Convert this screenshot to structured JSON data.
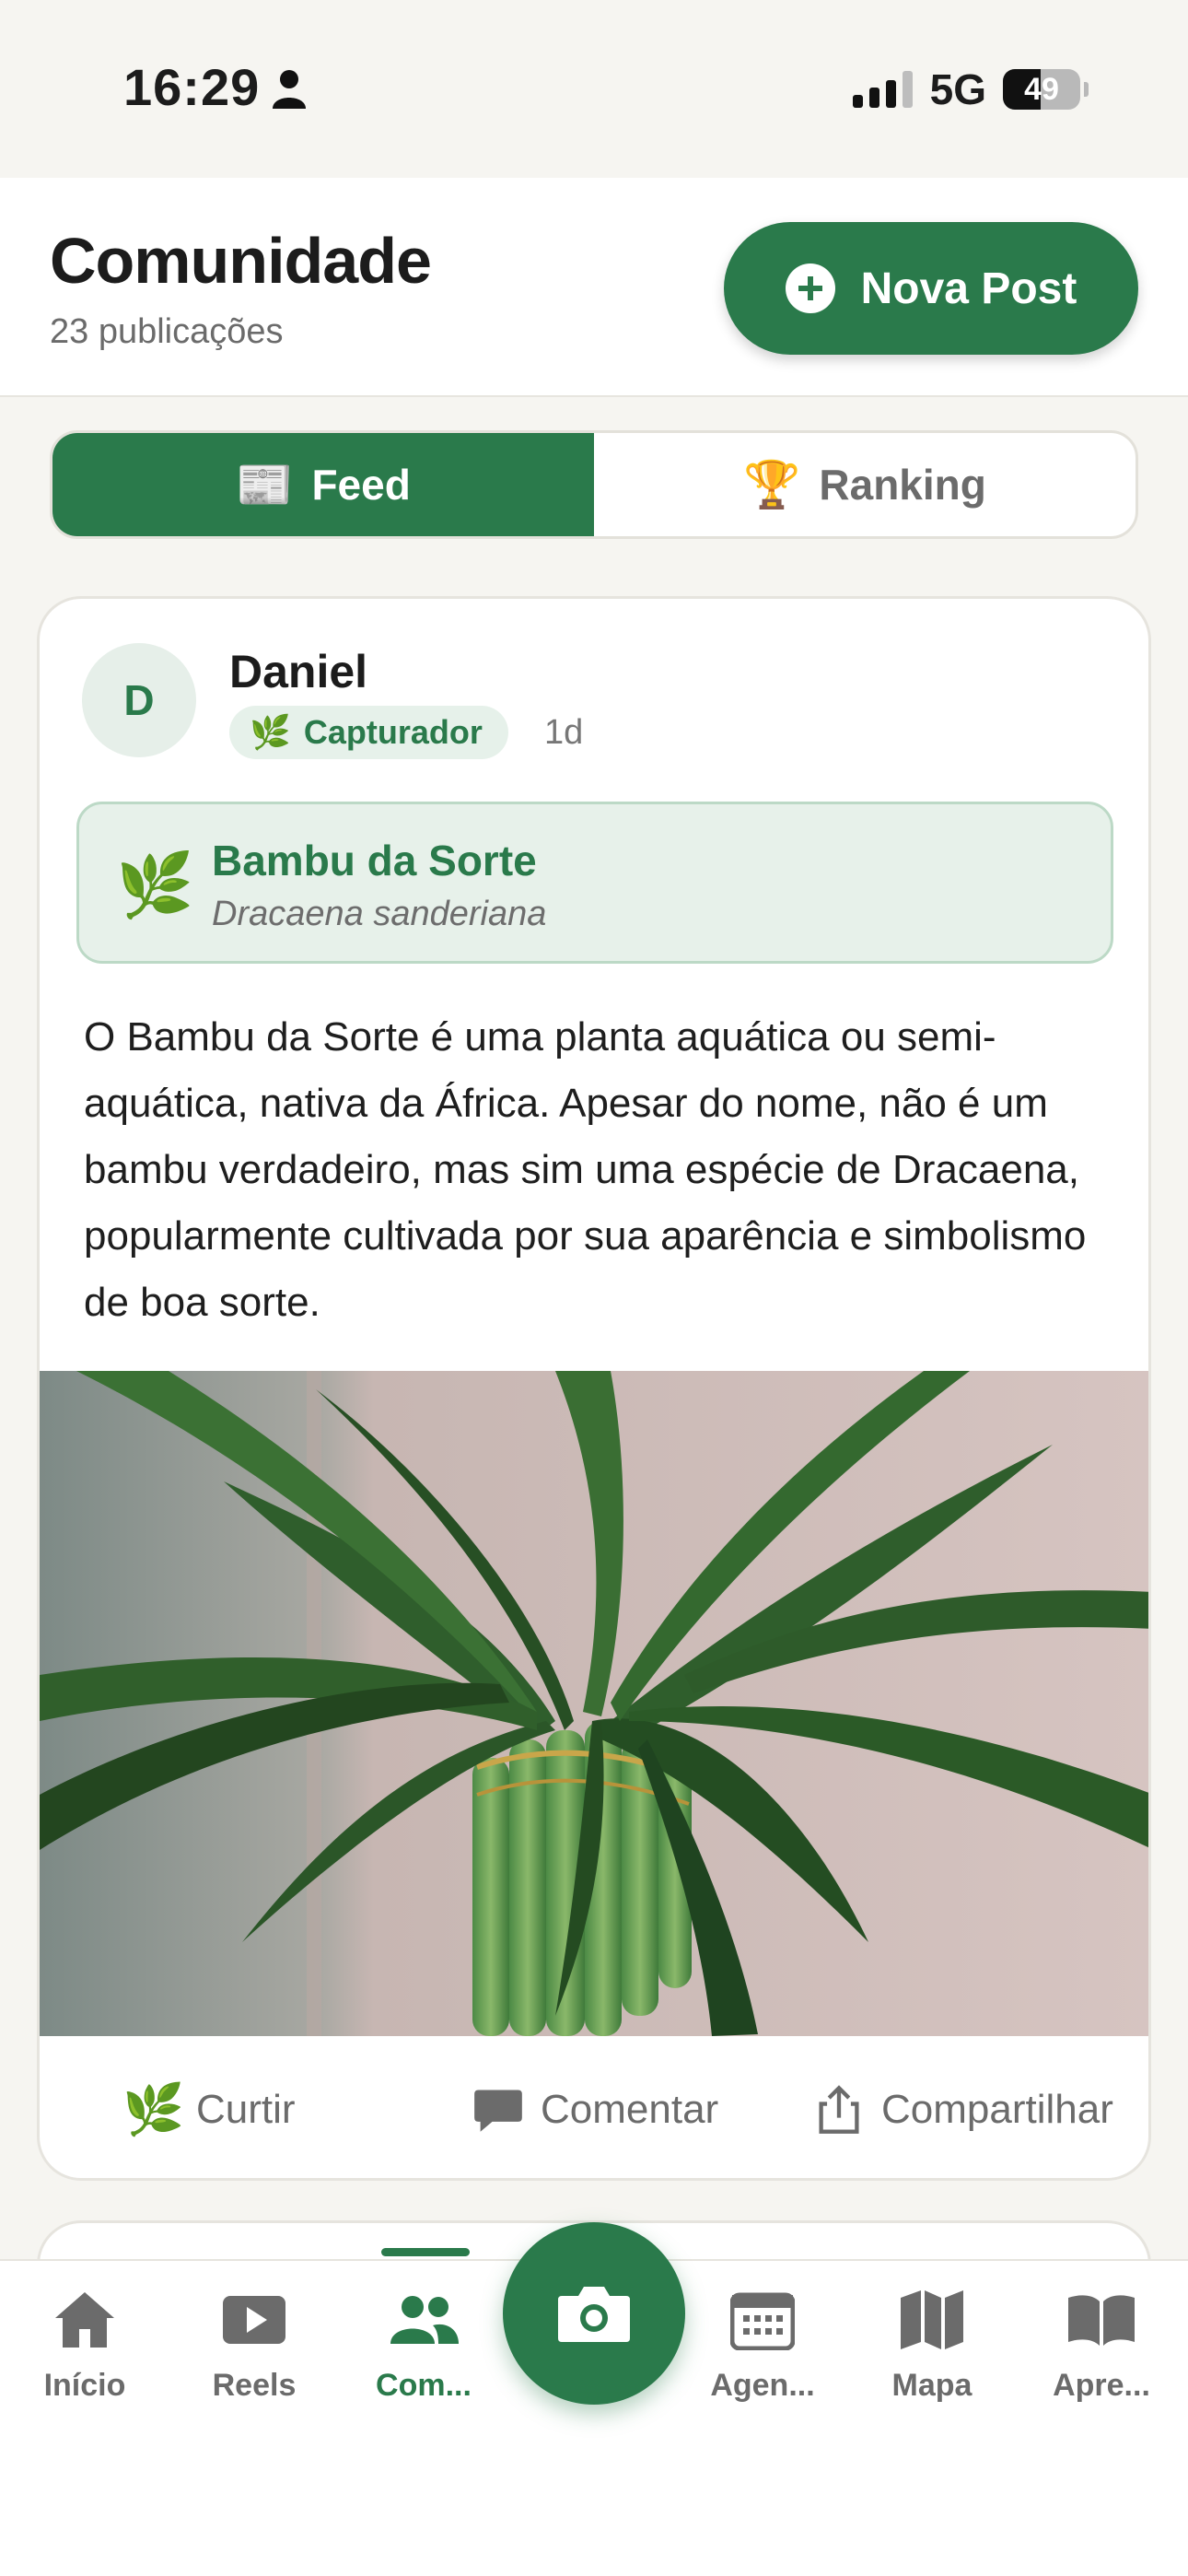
{
  "status_bar": {
    "time": "16:29",
    "network": "5G",
    "battery": "49"
  },
  "header": {
    "title": "Comunidade",
    "subtitle": "23 publicações",
    "new_post_label": "Nova Post"
  },
  "tabs": [
    {
      "icon": "📰",
      "label": "Feed",
      "active": true
    },
    {
      "icon": "🏆",
      "label": "Ranking",
      "active": false
    }
  ],
  "post": {
    "avatar_initial": "D",
    "author": "Daniel",
    "badge_icon": "🌿",
    "badge": "Capturador",
    "time": "1d",
    "plant_icon": "🌿",
    "plant_name": "Bambu da Sorte",
    "plant_scientific": "Dracaena sanderiana",
    "text": "O Bambu da Sorte é uma planta aquática ou semi-aquática, nativa da África. Apesar do nome, não é um bambu verdadeiro, mas sim uma espécie de Dracaena, popularmente cultivada por sua aparência e simbolismo de boa sorte.",
    "actions": {
      "like_icon": "🌿",
      "like": "Curtir",
      "comment": "Comentar",
      "share": "Compartilhar"
    }
  },
  "bottom_nav": [
    {
      "label": "Início",
      "icon": "home-icon"
    },
    {
      "label": "Reels",
      "icon": "play-icon"
    },
    {
      "label": "Com...",
      "icon": "people-icon",
      "active": true
    },
    {
      "label": "",
      "icon": "camera-icon"
    },
    {
      "label": "Agen...",
      "icon": "calendar-icon"
    },
    {
      "label": "Mapa",
      "icon": "map-icon"
    },
    {
      "label": "Apre...",
      "icon": "book-icon"
    }
  ],
  "colors": {
    "brand": "#2a7a4b",
    "background": "#f6f5f1",
    "muted": "#6b6b6b"
  }
}
